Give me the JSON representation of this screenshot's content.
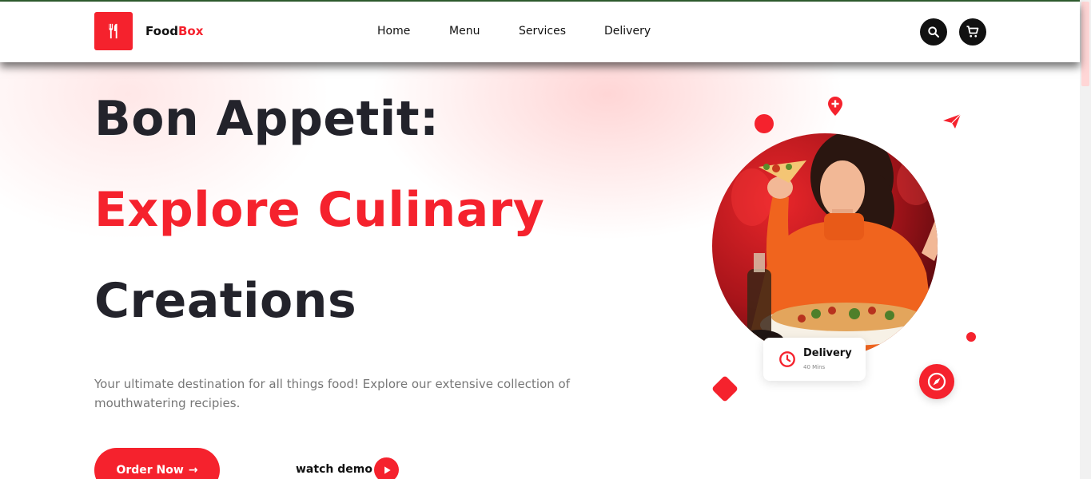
{
  "brand": {
    "name_dark": "Food",
    "name_accent": "Box"
  },
  "nav": {
    "items": [
      {
        "label": "Home"
      },
      {
        "label": "Menu"
      },
      {
        "label": "Services"
      },
      {
        "label": "Delivery"
      }
    ]
  },
  "hero": {
    "line1": "Bon Appetit:",
    "line2": "Explore Culinary",
    "line3": "Creations",
    "description": "Your ultimate destination for all things food! Explore our extensive collection of mouthwatering recipies.",
    "order_button": "Order Now",
    "order_arrow": "→",
    "watch_demo": "watch demo"
  },
  "delivery_card": {
    "title": "Delivery",
    "subtitle": "40 Mins"
  },
  "icons": {
    "logo": "fork-knife-icon",
    "search": "search-icon",
    "cart": "cart-icon",
    "play": "play-icon",
    "clock": "clock-icon",
    "compass": "compass-icon",
    "location": "location-pin-icon",
    "send": "paper-plane-icon"
  },
  "colors": {
    "accent": "#f5222d",
    "heading": "#23232b",
    "text_muted": "#777777",
    "dark_button": "#111111"
  }
}
